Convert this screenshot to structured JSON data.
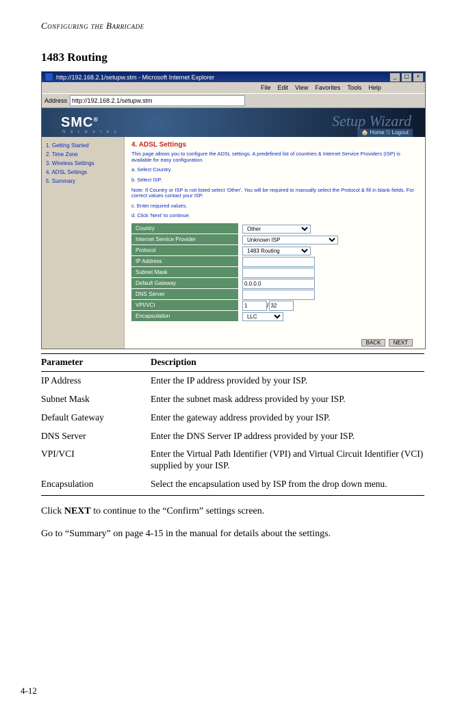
{
  "running_head": "Configuring the Barricade",
  "section_title": "1483 Routing",
  "browser": {
    "title": "http://192.168.2.1/setupw.stm - Microsoft Internet Explorer",
    "address_label": "Address",
    "url": "http://192.168.2.1/setupw.stm",
    "menus": [
      "File",
      "Edit",
      "View",
      "Favorites",
      "Tools",
      "Help"
    ]
  },
  "smc": {
    "logo": "SMC",
    "logo_sub": "N e t w o r k s",
    "setup": "Setup Wizard",
    "home_logout": "🏠 Home  ⎋ Logout"
  },
  "sidebar": [
    "1. Getting Started",
    "2. Time Zone",
    "3. Wireless Settings",
    "4. ADSL Settings",
    "5. Summary"
  ],
  "wizard": {
    "heading": "4. ADSL Settings",
    "intro": "This page allows you to configure the ADSL settings. A predefined list of countries & Internet Service Providers (ISP) is available for easy configuration.",
    "step_a": "a. Select Country.",
    "step_b": "b. Select ISP.",
    "note": "Note: If Country or ISP is not listed select 'Other'. You will be required to manually select the Protocol & fill in blank fields. For correct values contact your ISP.",
    "step_c": "c. Enter required values.",
    "step_d": "d. Click 'Next' to continue.",
    "rows": {
      "country": {
        "label": "Country",
        "value": "Other"
      },
      "isp": {
        "label": "Internet Service Provider",
        "value": "Unknown ISP"
      },
      "protocol": {
        "label": "Protocol",
        "value": "1483 Routing"
      },
      "ip": {
        "label": "IP Address",
        "value": ""
      },
      "subnet": {
        "label": "Subnet Mask",
        "value": ""
      },
      "gateway": {
        "label": "Default Gateway",
        "value": "0.0.0.0"
      },
      "dns": {
        "label": "DNS Server",
        "value": ""
      },
      "vpi": {
        "label": "VPI/VCI",
        "v1": "1",
        "sep": "/",
        "v2": "32"
      },
      "encap": {
        "label": "Encapsulation",
        "value": "LLC"
      }
    },
    "back": "BACK",
    "next": "NEXT"
  },
  "table": {
    "h1": "Parameter",
    "h2": "Description",
    "rows": [
      {
        "p": "IP Address",
        "d": "Enter the IP address provided by your ISP."
      },
      {
        "p": "Subnet Mask",
        "d": "Enter the subnet mask address provided by your ISP."
      },
      {
        "p": "Default Gateway",
        "d": "Enter the gateway address provided by your ISP."
      },
      {
        "p": "DNS Server",
        "d": "Enter the DNS Server IP address provided by your ISP."
      },
      {
        "p": "VPI/VCI",
        "d": "Enter the Virtual Path Identifier (VPI) and Virtual Circuit Identifier (VCI) supplied by your ISP."
      },
      {
        "p": "Encapsulation",
        "d": "Select the encapsulation used by ISP from the drop down menu."
      }
    ]
  },
  "para1_a": "Click ",
  "para1_b": "NEXT",
  "para1_c": " to continue to the “Confirm” settings screen.",
  "para2": "Go to “Summary” on page 4-15 in the manual for details about the settings.",
  "page_number": "4-12"
}
